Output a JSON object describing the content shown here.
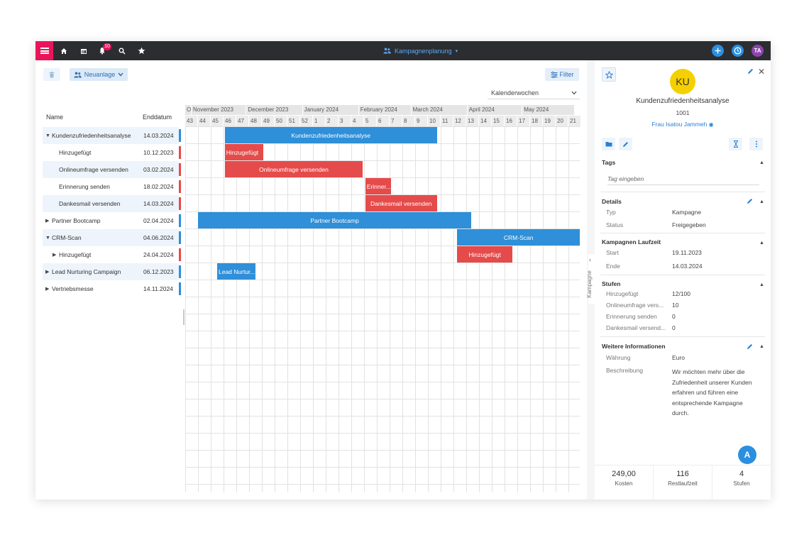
{
  "topbar": {
    "title": "Kampagnenplanung",
    "notification_count": "10",
    "user_initials": "TA",
    "colors": {
      "bar": "#2b2d31",
      "menu": "#e8155b",
      "add": "#2b8fe0",
      "history": "#2b8fe0",
      "user": "#8e44ad"
    },
    "icons": [
      "menu-icon",
      "home-icon",
      "calendar-icon",
      "bell-icon",
      "search-icon",
      "star-icon",
      "users-icon",
      "chevron-down-icon",
      "plus-icon",
      "clock-icon"
    ]
  },
  "toolbar": {
    "new_label": "Neuanlage",
    "filter_label": "Filter",
    "view_select": "Kalenderwochen"
  },
  "list": {
    "col_name": "Name",
    "col_end": "Enddatum",
    "rows": [
      {
        "name": "Kundenzufriedenheitsanalyse",
        "end": "14.03.2024",
        "arrow": "▼",
        "indent": 0,
        "color": "#2f8fd8"
      },
      {
        "name": "Hinzugefügt",
        "end": "10.12.2023",
        "arrow": "",
        "indent": 1,
        "color": "#e54b4b"
      },
      {
        "name": "Onlineumfrage versenden",
        "end": "03.02.2024",
        "arrow": "",
        "indent": 1,
        "color": "#e54b4b"
      },
      {
        "name": "Erinnerung senden",
        "end": "18.02.2024",
        "arrow": "",
        "indent": 1,
        "color": "#e54b4b"
      },
      {
        "name": "Dankesmail versenden",
        "end": "14.03.2024",
        "arrow": "",
        "indent": 1,
        "color": "#e54b4b"
      },
      {
        "name": "Partner Bootcamp",
        "end": "02.04.2024",
        "arrow": "▶",
        "indent": 0,
        "color": "#2f8fd8"
      },
      {
        "name": "CRM-Scan",
        "end": "04.06.2024",
        "arrow": "▼",
        "indent": 0,
        "color": "#2f8fd8"
      },
      {
        "name": "Hinzugefügt",
        "end": "24.04.2024",
        "arrow": "▶",
        "indent": 1,
        "color": "#e54b4b"
      },
      {
        "name": "Lead Nurturing Campaign",
        "end": "06.12.2023",
        "arrow": "▶",
        "indent": 0,
        "color": "#2f8fd8"
      },
      {
        "name": "Vertriebsmesse",
        "end": "14.11.2024",
        "arrow": "▶",
        "indent": 0,
        "color": "#2f8fd8"
      }
    ]
  },
  "gantt": {
    "months": [
      "O.",
      "November 2023",
      "December 2023",
      "January 2024",
      "February 2024",
      "March 2024",
      "April 2024",
      "May 2024"
    ],
    "month_week_spans": [
      0.5,
      4.3,
      4.4,
      4.4,
      4.1,
      4.4,
      4.3,
      4.1
    ],
    "weeks": [
      "43",
      "44",
      "45",
      "46",
      "47",
      "48",
      "49",
      "50",
      "51",
      "52",
      "1",
      "2",
      "3",
      "4",
      "5",
      "6",
      "7",
      "8",
      "9",
      "10",
      "11",
      "12",
      "13",
      "14",
      "15",
      "16",
      "17",
      "18",
      "19",
      "20",
      "21"
    ],
    "bars": [
      {
        "row": 0,
        "label": "Kundenzufriedenheitsanalyse",
        "start_week": 3.1,
        "weeks": 16.6,
        "color": "blue",
        "align": "center"
      },
      {
        "row": 1,
        "label": "Hinzugefügt",
        "start_week": 3.1,
        "weeks": 3.0,
        "color": "red",
        "align": "left"
      },
      {
        "row": 2,
        "label": "Onlineumfrage versenden",
        "start_week": 3.1,
        "weeks": 10.8,
        "color": "red",
        "align": "center"
      },
      {
        "row": 3,
        "label": "Erinner...",
        "start_week": 14.1,
        "weeks": 2.0,
        "color": "red",
        "align": "left"
      },
      {
        "row": 4,
        "label": "Dankesmail versenden",
        "start_week": 14.1,
        "weeks": 5.6,
        "color": "red",
        "align": "center"
      },
      {
        "row": 5,
        "label": "Partner Bootcamp",
        "start_week": 1.0,
        "weeks": 21.4,
        "color": "blue",
        "align": "center"
      },
      {
        "row": 6,
        "label": "CRM-Scan",
        "start_week": 21.3,
        "weeks": 9.6,
        "color": "blue",
        "align": "center"
      },
      {
        "row": 7,
        "label": "Hinzugefügt",
        "start_week": 21.3,
        "weeks": 4.3,
        "color": "red",
        "align": "center"
      },
      {
        "row": 8,
        "label": "Lead Nurtur...",
        "start_week": 2.5,
        "weeks": 3.0,
        "color": "blue",
        "align": "left"
      }
    ]
  },
  "side_tab": {
    "label": "Kampagne"
  },
  "detail": {
    "avatar": "KU",
    "title": "Kundenzufriedenheitsanalyse",
    "id": "1001",
    "owner": "Frau Isatou Jammeh",
    "tags_title": "Tags",
    "tags_placeholder": "Tag eingeben",
    "details_title": "Details",
    "details": [
      {
        "k": "Typ",
        "v": "Kampagne"
      },
      {
        "k": "Status",
        "v": "Freigegeben"
      }
    ],
    "laufzeit_title": "Kampagnen Laufzeit",
    "laufzeit": [
      {
        "k": "Start",
        "v": "19.11.2023"
      },
      {
        "k": "Ende",
        "v": "14.03.2024"
      }
    ],
    "stufen_title": "Stufen",
    "stufen": [
      {
        "k": "Hinzugefügt",
        "v": "12/100"
      },
      {
        "k": "Onlineumfrage vers...",
        "v": "10"
      },
      {
        "k": "Erinnerung senden",
        "v": "0"
      },
      {
        "k": "Dankesmail versend...",
        "v": "0"
      }
    ],
    "weitere_title": "Weitere Informationen",
    "weitere": [
      {
        "k": "Währung",
        "v": "Euro"
      },
      {
        "k": "Beschreibung",
        "v": ""
      }
    ],
    "description": "Wir möchten mehr über die Zufriedenheit unserer Kunden erfahren und führen eine entsprechende Kampagne durch.",
    "fab_label": "A",
    "stats": [
      {
        "v": "249,00",
        "l": "Kosten"
      },
      {
        "v": "116",
        "l": "Restlaufzeit"
      },
      {
        "v": "4",
        "l": "Stufen"
      }
    ]
  }
}
